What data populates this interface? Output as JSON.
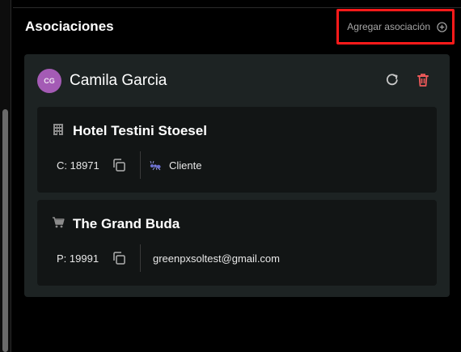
{
  "section": {
    "title": "Asociaciones",
    "add_label": "Agregar asociación"
  },
  "contact": {
    "initials": "CG",
    "name": "Camila Garcia",
    "avatar_color": "#a45bb5"
  },
  "associations": [
    {
      "icon": "building-icon",
      "company": "Hotel Testini Stoesel",
      "code": "C: 18971",
      "detail_icon": "ant-icon",
      "detail": "Cliente"
    },
    {
      "icon": "shopping-cart-icon",
      "company": "The Grand Buda",
      "code": "P: 19991",
      "detail": "greenpxsoltest@gmail.com"
    }
  ],
  "colors": {
    "highlight_border": "#ff1a1a",
    "delete_icon": "#ef5a5a",
    "card_bg": "#1d2323",
    "sub_card_bg": "#121515"
  }
}
